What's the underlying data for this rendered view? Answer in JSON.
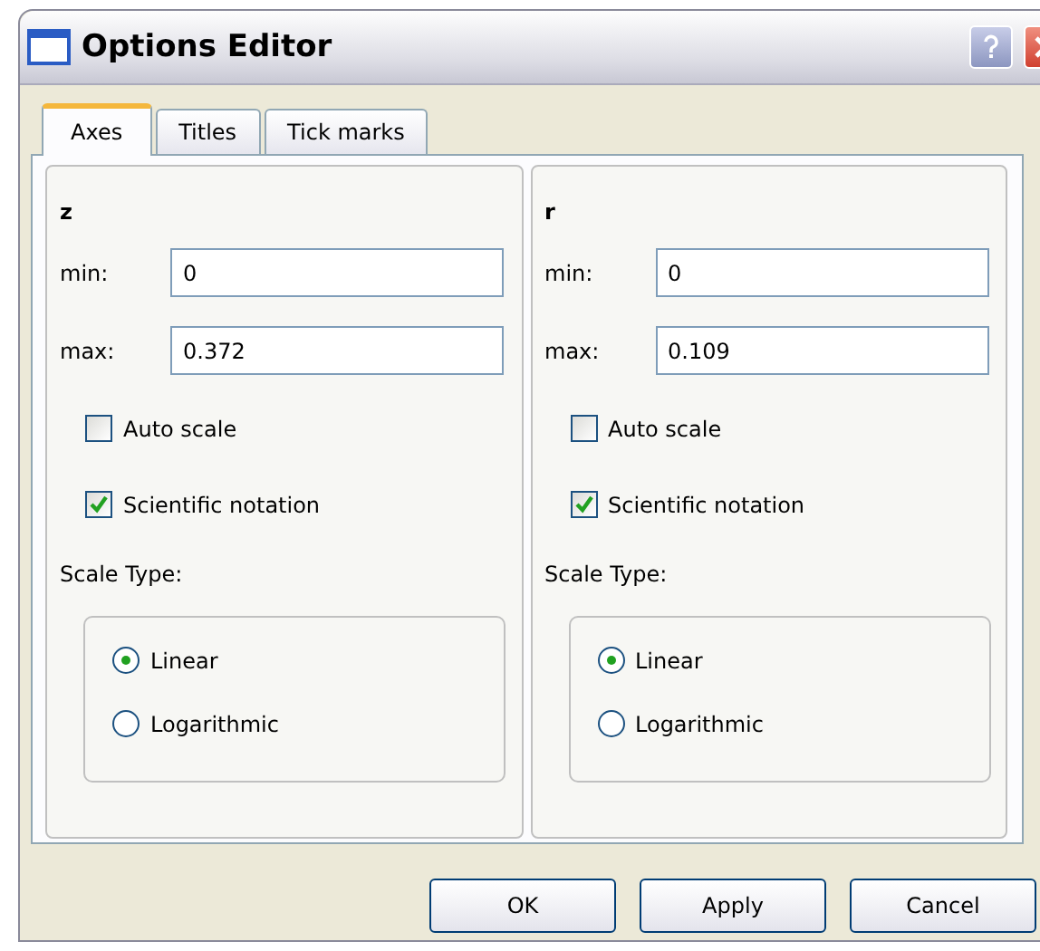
{
  "window": {
    "title": "Options Editor"
  },
  "tabs": [
    {
      "label": "Axes",
      "selected": true
    },
    {
      "label": "Titles",
      "selected": false
    },
    {
      "label": "Tick marks",
      "selected": false
    }
  ],
  "axes": [
    {
      "name": "z",
      "min_label": "min:",
      "min": "0",
      "max_label": "max:",
      "max": "0.372",
      "auto_scale": {
        "label": "Auto scale",
        "checked": false
      },
      "scientific": {
        "label": "Scientific notation",
        "checked": true
      },
      "scale_type_label": "Scale Type:",
      "scale_types": [
        {
          "label": "Linear",
          "selected": true
        },
        {
          "label": "Logarithmic",
          "selected": false
        }
      ]
    },
    {
      "name": "r",
      "min_label": "min:",
      "min": "0",
      "max_label": "max:",
      "max": "0.109",
      "auto_scale": {
        "label": "Auto scale",
        "checked": false
      },
      "scientific": {
        "label": "Scientific notation",
        "checked": true
      },
      "scale_type_label": "Scale Type:",
      "scale_types": [
        {
          "label": "Linear",
          "selected": true
        },
        {
          "label": "Logarithmic",
          "selected": false
        }
      ]
    }
  ],
  "buttons": [
    "OK",
    "Apply",
    "Cancel"
  ]
}
